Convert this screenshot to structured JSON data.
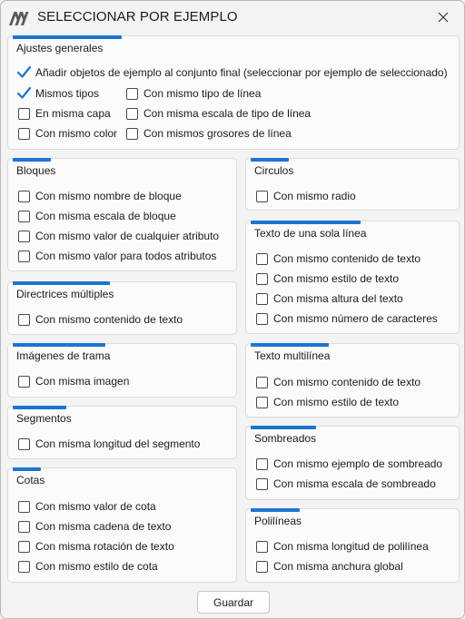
{
  "window": {
    "title": "SELECCIONAR POR EJEMPLO"
  },
  "colors": {
    "accent": "#1d74d1",
    "check": "#1d74d1"
  },
  "general": {
    "title": "Ajustes generales",
    "items": [
      {
        "label": "Añadir objetos de ejemplo al conjunto final (seleccionar por ejemplo de seleccionado)",
        "checked": true
      },
      {
        "label": "Mismos tipos",
        "checked": true
      },
      {
        "label": "Con mismo tipo de línea",
        "checked": false
      },
      {
        "label": "En misma capa",
        "checked": false
      },
      {
        "label": "Con misma escala de tipo de línea",
        "checked": false
      },
      {
        "label": "Con mismo color",
        "checked": false
      },
      {
        "label": "Con mismos grosores de línea",
        "checked": false
      }
    ]
  },
  "bloques": {
    "title": "Bloques",
    "items": [
      {
        "label": "Con mismo nombre de bloque",
        "checked": false
      },
      {
        "label": "Con misma escala de bloque",
        "checked": false
      },
      {
        "label": "Con mismo valor de cualquier atributo",
        "checked": false
      },
      {
        "label": "Con mismo valor para todos atributos",
        "checked": false
      }
    ]
  },
  "circulos": {
    "title": "Circulos",
    "items": [
      {
        "label": "Con mismo radio",
        "checked": false
      }
    ]
  },
  "texto_sola": {
    "title": "Texto de una sola línea",
    "items": [
      {
        "label": "Con mismo contenido de texto",
        "checked": false
      },
      {
        "label": "Con mismo estilo de texto",
        "checked": false
      },
      {
        "label": "Con misma altura del texto",
        "checked": false
      },
      {
        "label": "Con mismo número de caracteres",
        "checked": false
      }
    ]
  },
  "directrices": {
    "title": "Directrices múltiples",
    "items": [
      {
        "label": "Con mismo contenido de texto",
        "checked": false
      }
    ]
  },
  "imagenes": {
    "title": "Imágenes de trama",
    "items": [
      {
        "label": "Con misma imagen",
        "checked": false
      }
    ]
  },
  "texto_multi": {
    "title": "Texto multilínea",
    "items": [
      {
        "label": "Con mismo contenido de texto",
        "checked": false
      },
      {
        "label": "Con mismo estilo de texto",
        "checked": false
      }
    ]
  },
  "segmentos": {
    "title": "Segmentos",
    "items": [
      {
        "label": "Con misma longitud del segmento",
        "checked": false
      }
    ]
  },
  "sombreados": {
    "title": "Sombreados",
    "items": [
      {
        "label": "Con mismo ejemplo de sombreado",
        "checked": false
      },
      {
        "label": "Con misma escala de sombreado",
        "checked": false
      }
    ]
  },
  "cotas": {
    "title": "Cotas",
    "items": [
      {
        "label": "Con mismo valor de cota",
        "checked": false
      },
      {
        "label": "Con misma cadena de texto",
        "checked": false
      },
      {
        "label": "Con misma rotación de texto",
        "checked": false
      },
      {
        "label": "Con mismo estilo de cota",
        "checked": false
      }
    ]
  },
  "polilineas": {
    "title": "Polilíneas",
    "items": [
      {
        "label": "Con misma longitud de polilínea",
        "checked": false
      },
      {
        "label": "Con misma anchura global",
        "checked": false
      }
    ]
  },
  "footer": {
    "save_label": "Guardar"
  }
}
